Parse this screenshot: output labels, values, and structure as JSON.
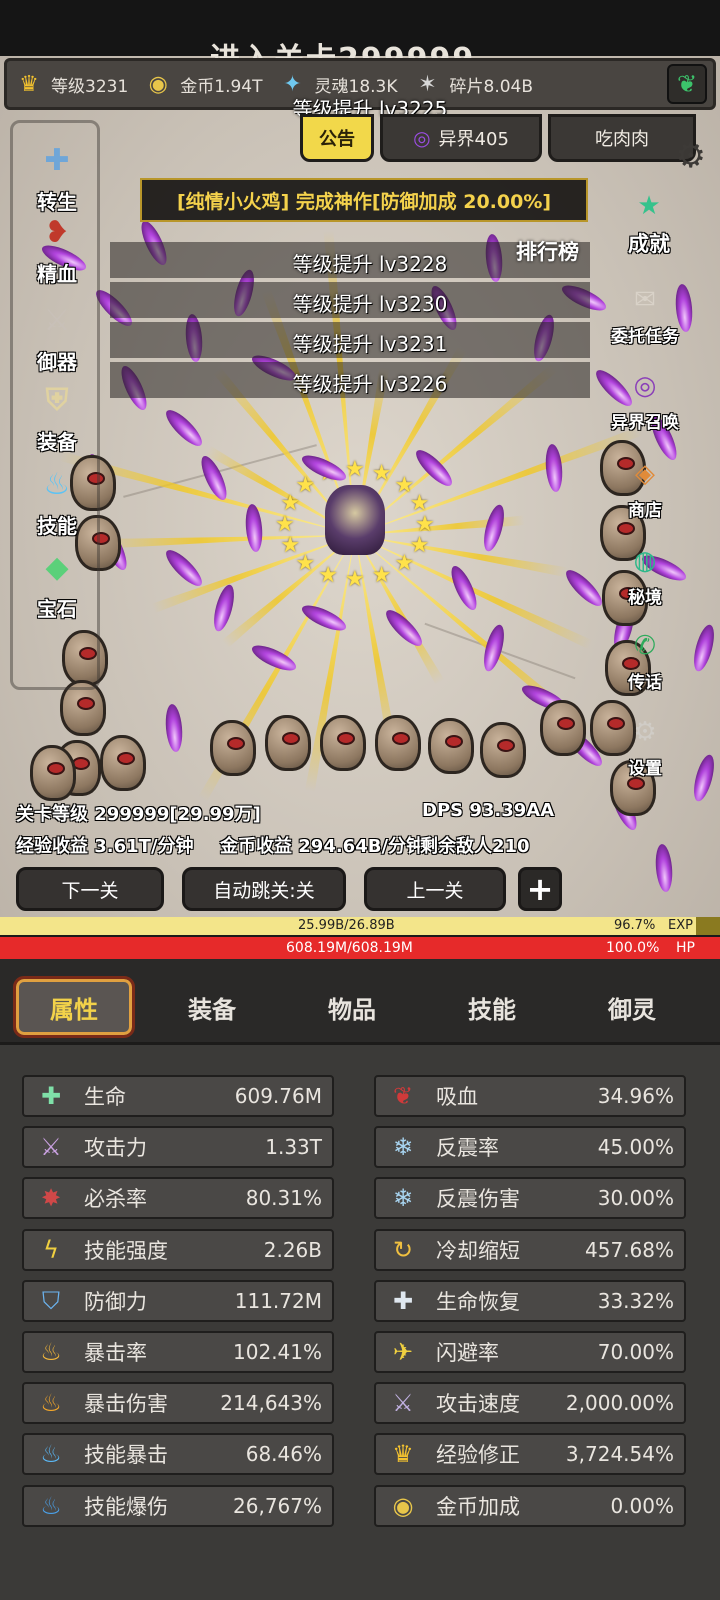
{
  "stage_title": "进入关卡299999",
  "resources": [
    {
      "icon": "crown-icon",
      "glyph": "♛",
      "color": "#f3c22f",
      "text": "等级3231"
    },
    {
      "icon": "gold-coin-icon",
      "glyph": "◉",
      "color": "#e8c64a",
      "text": "金币1.94T"
    },
    {
      "icon": "soul-flame-icon",
      "glyph": "✦",
      "color": "#6fc8ef",
      "text": "灵魂18.3K"
    },
    {
      "icon": "shard-icon",
      "glyph": "✶",
      "color": "#d8d8d8",
      "text": "碎片8.04B"
    }
  ],
  "top_tabs": {
    "notice": "公告",
    "otherworld": "异界405",
    "player_name": "吃肉肉"
  },
  "log_lines": [
    "等级提升 lv3225",
    "等级提升 lv3228",
    "等级提升 lv3230",
    "等级提升 lv3231",
    "等级提升 lv3226"
  ],
  "announcement": "[纯情小火鸡] 完成神作[防御加成 20.00%]",
  "left_menu": [
    {
      "label": "转生",
      "icon": "rebirth-cross-icon",
      "glyph": "✚",
      "color": "#6fa6d8"
    },
    {
      "label": "精血",
      "icon": "blood-meat-icon",
      "glyph": "❥",
      "color": "#c0392b"
    },
    {
      "label": "御器",
      "icon": "sword-icon",
      "glyph": "⚔",
      "color": "#c8c0b8"
    },
    {
      "label": "装备",
      "icon": "armor-icon",
      "glyph": "⛨",
      "color": "#e0d2a0"
    },
    {
      "label": "技能",
      "icon": "blue-flame-icon",
      "glyph": "♨",
      "color": "#5bc3f5"
    },
    {
      "label": "宝石",
      "icon": "gem-bag-icon",
      "glyph": "◆",
      "color": "#5bd07a"
    }
  ],
  "right_menu": [
    {
      "label": "成就",
      "icon": "star-badge-icon",
      "glyph": "★",
      "color": "#35c28c"
    },
    {
      "label": "委托任务",
      "icon": "scroll-icon",
      "glyph": "✉",
      "color": "#d9d2c8"
    },
    {
      "label": "异界召唤",
      "icon": "portal-icon",
      "glyph": "◎",
      "color": "#8a3fb8"
    },
    {
      "label": "商店",
      "icon": "shop-bag-icon",
      "glyph": "◈",
      "color": "#e08b3a"
    },
    {
      "label": "秘境",
      "icon": "green-portal-icon",
      "glyph": "◍",
      "color": "#2eb88a"
    },
    {
      "label": "传话",
      "icon": "megaphone-icon",
      "glyph": "📣",
      "color": "#2faa5c"
    },
    {
      "label": "设置",
      "icon": "settings-gear-icon",
      "glyph": "⚙",
      "color": "#d0ccc6"
    }
  ],
  "leaderboard_label": "排行榜",
  "stage_level": "关卡等级 299999[29.99万]",
  "dps": "DPS 93.39AA",
  "exp_gain": "经验收益 3.61T/分钟",
  "gold_gain": "金币收益 294.64B/分钟",
  "enemies_left": "剩余敌人210",
  "controls": {
    "next": "下一关",
    "auto_skip": "自动跳关:关",
    "prev": "上一关",
    "plus": "+"
  },
  "exp_bar": {
    "text": "25.99B/26.89B",
    "percent": "96.7%",
    "label": "EXP",
    "fill": 0.967
  },
  "hp_bar": {
    "text": "608.19M/608.19M",
    "percent": "100.0%",
    "label": "HP",
    "fill": 1.0
  },
  "panel_tabs": [
    "属性",
    "装备",
    "物品",
    "技能",
    "御灵"
  ],
  "stats_left": [
    {
      "label": "生命",
      "value": "609.76M",
      "icon": "life-cross-icon",
      "glyph": "✚",
      "color": "#7fe0a8"
    },
    {
      "label": "攻击力",
      "value": "1.33T",
      "icon": "attack-sword-icon",
      "glyph": "⚔",
      "color": "#c9a0e0"
    },
    {
      "label": "必杀率",
      "value": "80.31%",
      "icon": "kill-splash-icon",
      "glyph": "✸",
      "color": "#d04848"
    },
    {
      "label": "技能强度",
      "value": "2.26B",
      "icon": "lightning-icon",
      "glyph": "ϟ",
      "color": "#f0d040"
    },
    {
      "label": "防御力",
      "value": "111.72M",
      "icon": "shield-icon",
      "glyph": "⛉",
      "color": "#6cb4f0"
    },
    {
      "label": "暴击率",
      "value": "102.41%",
      "icon": "crit-flame-icon",
      "glyph": "♨",
      "color": "#f5b83a"
    },
    {
      "label": "暴击伤害",
      "value": "214,643%",
      "icon": "crit-damage-flame-icon",
      "glyph": "♨",
      "color": "#f5a82a"
    },
    {
      "label": "技能暴击",
      "value": "68.46%",
      "icon": "skill-crit-flame-icon",
      "glyph": "♨",
      "color": "#5bb8f5"
    },
    {
      "label": "技能爆伤",
      "value": "26,767%",
      "icon": "skill-burst-flame-icon",
      "glyph": "♨",
      "color": "#4aa0e8"
    }
  ],
  "stats_right": [
    {
      "label": "吸血",
      "value": "34.96%",
      "icon": "bat-icon",
      "glyph": "❦",
      "color": "#d03a3a"
    },
    {
      "label": "反震率",
      "value": "45.00%",
      "icon": "frost-shatter-icon",
      "glyph": "❄",
      "color": "#a8d4f0"
    },
    {
      "label": "反震伤害",
      "value": "30.00%",
      "icon": "frost-damage-icon",
      "glyph": "❄",
      "color": "#a8d4f0"
    },
    {
      "label": "冷却缩短",
      "value": "457.68%",
      "icon": "cooldown-swirl-icon",
      "glyph": "↻",
      "color": "#f0c040"
    },
    {
      "label": "生命恢复",
      "value": "33.32%",
      "icon": "regen-cross-icon",
      "glyph": "✚",
      "color": "#e0e8f0"
    },
    {
      "label": "闪避率",
      "value": "70.00%",
      "icon": "winged-boot-icon",
      "glyph": "✈",
      "color": "#f0d040"
    },
    {
      "label": "攻击速度",
      "value": "2,000.00%",
      "icon": "speed-sword-icon",
      "glyph": "⚔",
      "color": "#c0b0e0"
    },
    {
      "label": "经验修正",
      "value": "3,724.54%",
      "icon": "exp-crown-icon",
      "glyph": "♛",
      "color": "#f3c22f"
    },
    {
      "label": "金币加成",
      "value": "0.00%",
      "icon": "gold-bonus-coin-icon",
      "glyph": "◉",
      "color": "#e8c64a"
    }
  ]
}
